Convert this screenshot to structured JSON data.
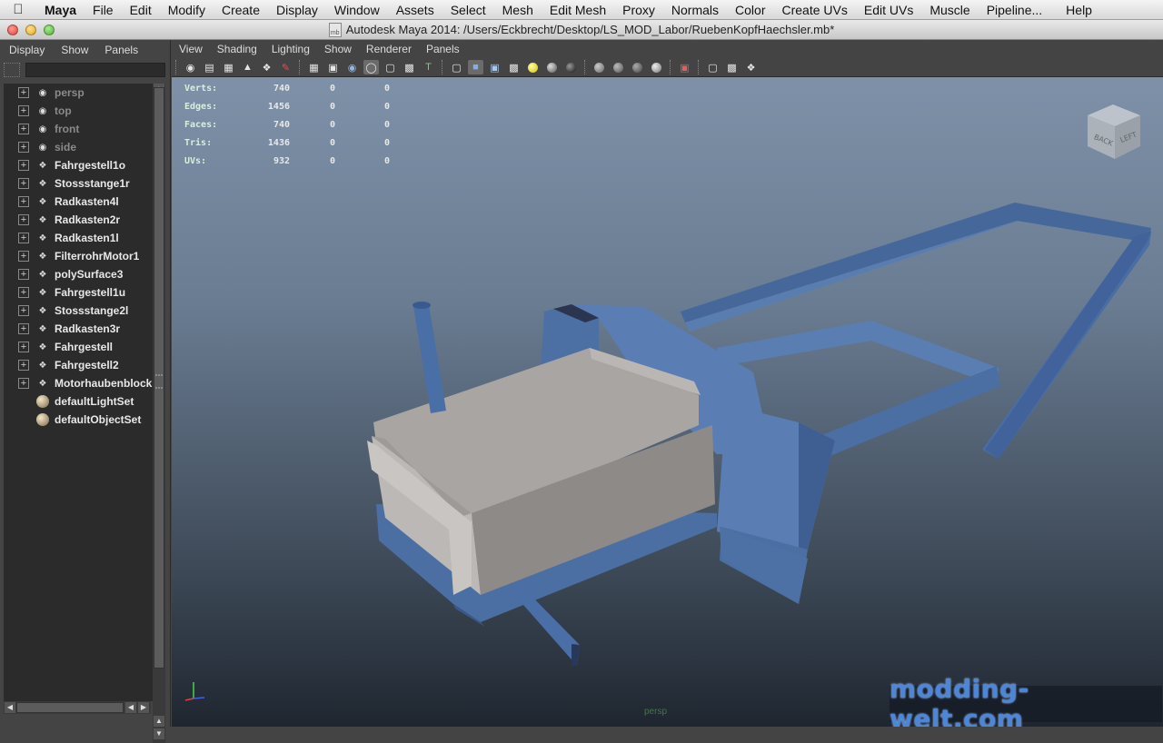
{
  "menubar": {
    "app": "Maya",
    "items": [
      "File",
      "Edit",
      "Modify",
      "Create",
      "Display",
      "Window",
      "Assets",
      "Select",
      "Mesh",
      "Edit Mesh",
      "Proxy",
      "Normals",
      "Color",
      "Create UVs",
      "Edit UVs",
      "Muscle",
      "Pipeline...",
      "Help"
    ]
  },
  "window": {
    "title": "Autodesk Maya 2014: /Users/Eckbrecht/Desktop/LS_MOD_Labor/RuebenKopfHaechsler.mb*",
    "doc_icon_text": "mb"
  },
  "outliner": {
    "menu": [
      "Display",
      "Show",
      "Panels"
    ],
    "filter_value": "",
    "nodes": [
      {
        "label": "persp",
        "kind": "camera"
      },
      {
        "label": "top",
        "kind": "camera"
      },
      {
        "label": "front",
        "kind": "camera"
      },
      {
        "label": "side",
        "kind": "camera"
      },
      {
        "label": "Fahrgestell1o",
        "kind": "mesh"
      },
      {
        "label": "Stossstange1r",
        "kind": "mesh"
      },
      {
        "label": "Radkasten4l",
        "kind": "mesh"
      },
      {
        "label": "Radkasten2r",
        "kind": "mesh"
      },
      {
        "label": "Radkasten1l",
        "kind": "mesh"
      },
      {
        "label": "FilterrohrMotor1",
        "kind": "mesh"
      },
      {
        "label": "polySurface3",
        "kind": "mesh"
      },
      {
        "label": "Fahrgestell1u",
        "kind": "mesh"
      },
      {
        "label": "Stossstange2l",
        "kind": "mesh"
      },
      {
        "label": "Radkasten3r",
        "kind": "mesh"
      },
      {
        "label": "Fahrgestell",
        "kind": "mesh"
      },
      {
        "label": "Fahrgestell2",
        "kind": "mesh"
      },
      {
        "label": "Motorhaubenblock",
        "kind": "mesh"
      },
      {
        "label": "defaultLightSet",
        "kind": "set"
      },
      {
        "label": "defaultObjectSet",
        "kind": "set"
      }
    ]
  },
  "panel": {
    "menu": [
      "View",
      "Shading",
      "Lighting",
      "Show",
      "Renderer",
      "Panels"
    ],
    "camera": "persp"
  },
  "hud": {
    "rows": [
      {
        "label": "Verts:",
        "values": [
          "740",
          "0",
          "0"
        ]
      },
      {
        "label": "Edges:",
        "values": [
          "1456",
          "0",
          "0"
        ]
      },
      {
        "label": "Faces:",
        "values": [
          "740",
          "0",
          "0"
        ]
      },
      {
        "label": "Tris:",
        "values": [
          "1436",
          "0",
          "0"
        ]
      },
      {
        "label": "UVs:",
        "values": [
          "932",
          "0",
          "0"
        ]
      }
    ]
  },
  "viewcube": {
    "faces": [
      "BACK",
      "LEFT"
    ]
  },
  "watermark": "modding-welt.com",
  "colors": {
    "model_blue": "#4e6fa3",
    "engine_grey": "#a8a4a2",
    "hud_green": "#d8f0d8"
  }
}
